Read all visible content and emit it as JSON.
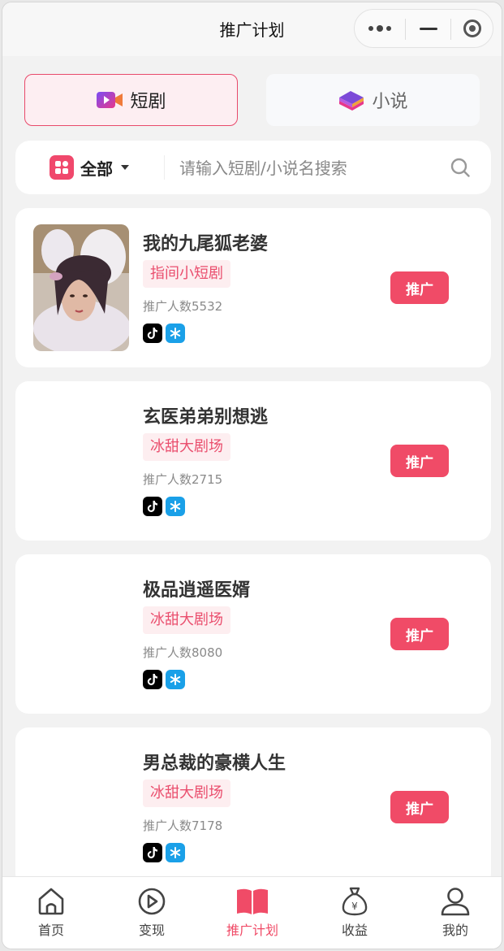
{
  "titlebar": {
    "title": "推广计划"
  },
  "tabs": [
    {
      "label": "短剧",
      "icon": "video-icon",
      "active": true
    },
    {
      "label": "小说",
      "icon": "book-icon",
      "active": false
    }
  ],
  "filter": {
    "label": "全部",
    "icon": "grid-icon"
  },
  "search": {
    "placeholder": "请输入短剧/小说名搜索"
  },
  "cards": [
    {
      "title": "我的九尾狐老婆",
      "tag": "指间小短剧",
      "count": "推广人数5532",
      "button": "推广",
      "has_cover": true
    },
    {
      "title": "玄医弟弟别想逃",
      "tag": "冰甜大剧场",
      "count": "推广人数2715",
      "button": "推广",
      "has_cover": false
    },
    {
      "title": "极品逍遥医婿",
      "tag": "冰甜大剧场",
      "count": "推广人数8080",
      "button": "推广",
      "has_cover": false
    },
    {
      "title": "男总裁的豪横人生",
      "tag": "冰甜大剧场",
      "count": "推广人数7178",
      "button": "推广",
      "has_cover": false
    }
  ],
  "nav": [
    {
      "label": "首页",
      "icon": "home-icon"
    },
    {
      "label": "变现",
      "icon": "play-circle-icon"
    },
    {
      "label": "推广计划",
      "icon": "open-book-icon",
      "active": true
    },
    {
      "label": "收益",
      "icon": "money-bag-icon"
    },
    {
      "label": "我的",
      "icon": "user-icon"
    }
  ],
  "colors": {
    "accent": "#f04b67",
    "tag_bg": "#fdeef0",
    "tag_text": "#ea4f6e"
  }
}
